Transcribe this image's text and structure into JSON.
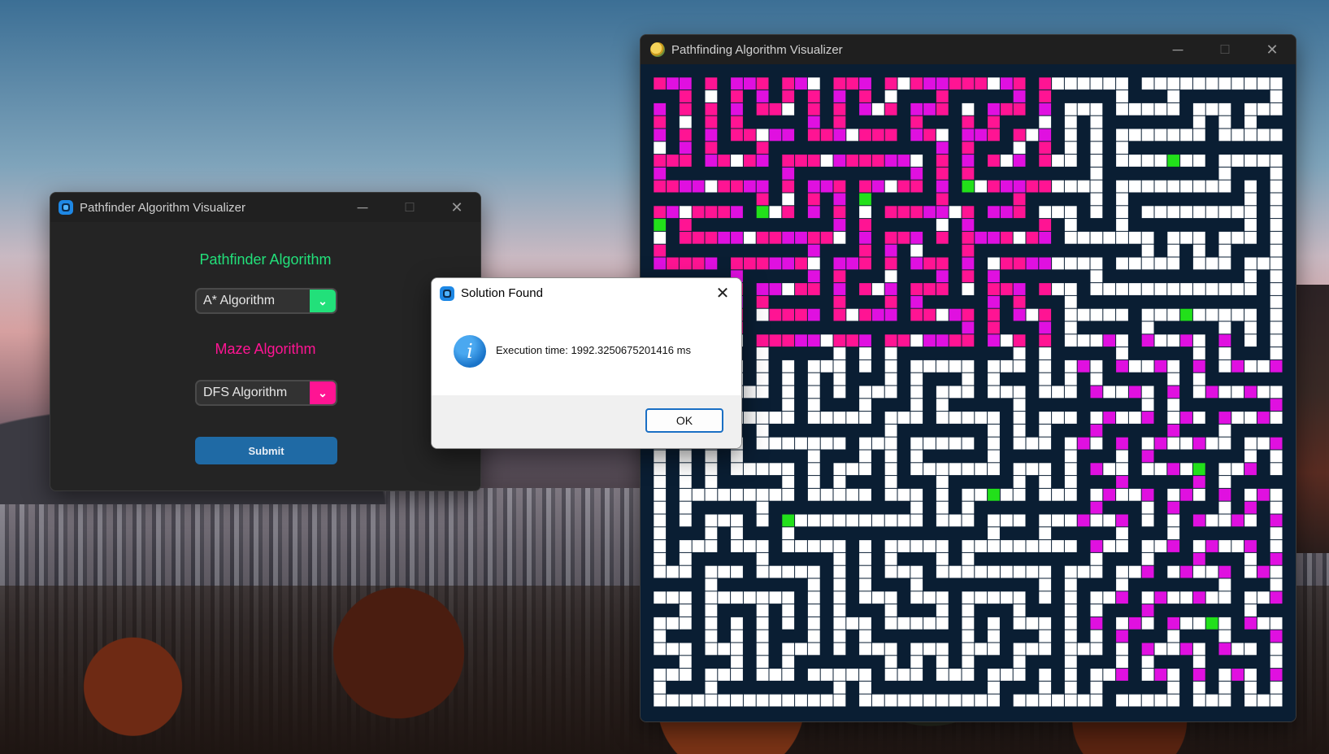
{
  "pathfinder_window": {
    "title": "Pathfinder Algorithm Visualizer",
    "pathfinder_heading": "Pathfinder Algorithm",
    "pathfinder_selected": "A* Algorithm",
    "maze_heading": "Maze Algorithm",
    "maze_selected": "DFS Algorithm",
    "submit_label": "Submit",
    "colors": {
      "pathfinder_accent": "#22e07a",
      "maze_accent": "#ff1493",
      "submit": "#1f6aa5"
    }
  },
  "maze_window": {
    "title": "Pathfinding Algorithm Visualizer",
    "colors": {
      "wall": "#0a1e33",
      "open": "#ffffff",
      "path_pink": "#ff1493",
      "path_magenta": "#e010e0",
      "node_green": "#22e01a"
    }
  },
  "dialog": {
    "title": "Solution Found",
    "message": "Execution time: 1992.3250675201416 ms",
    "ok_label": "OK",
    "icon": "info-icon"
  },
  "window_controls": {
    "minimize": "─",
    "maximize": "☐",
    "close": "✕"
  }
}
